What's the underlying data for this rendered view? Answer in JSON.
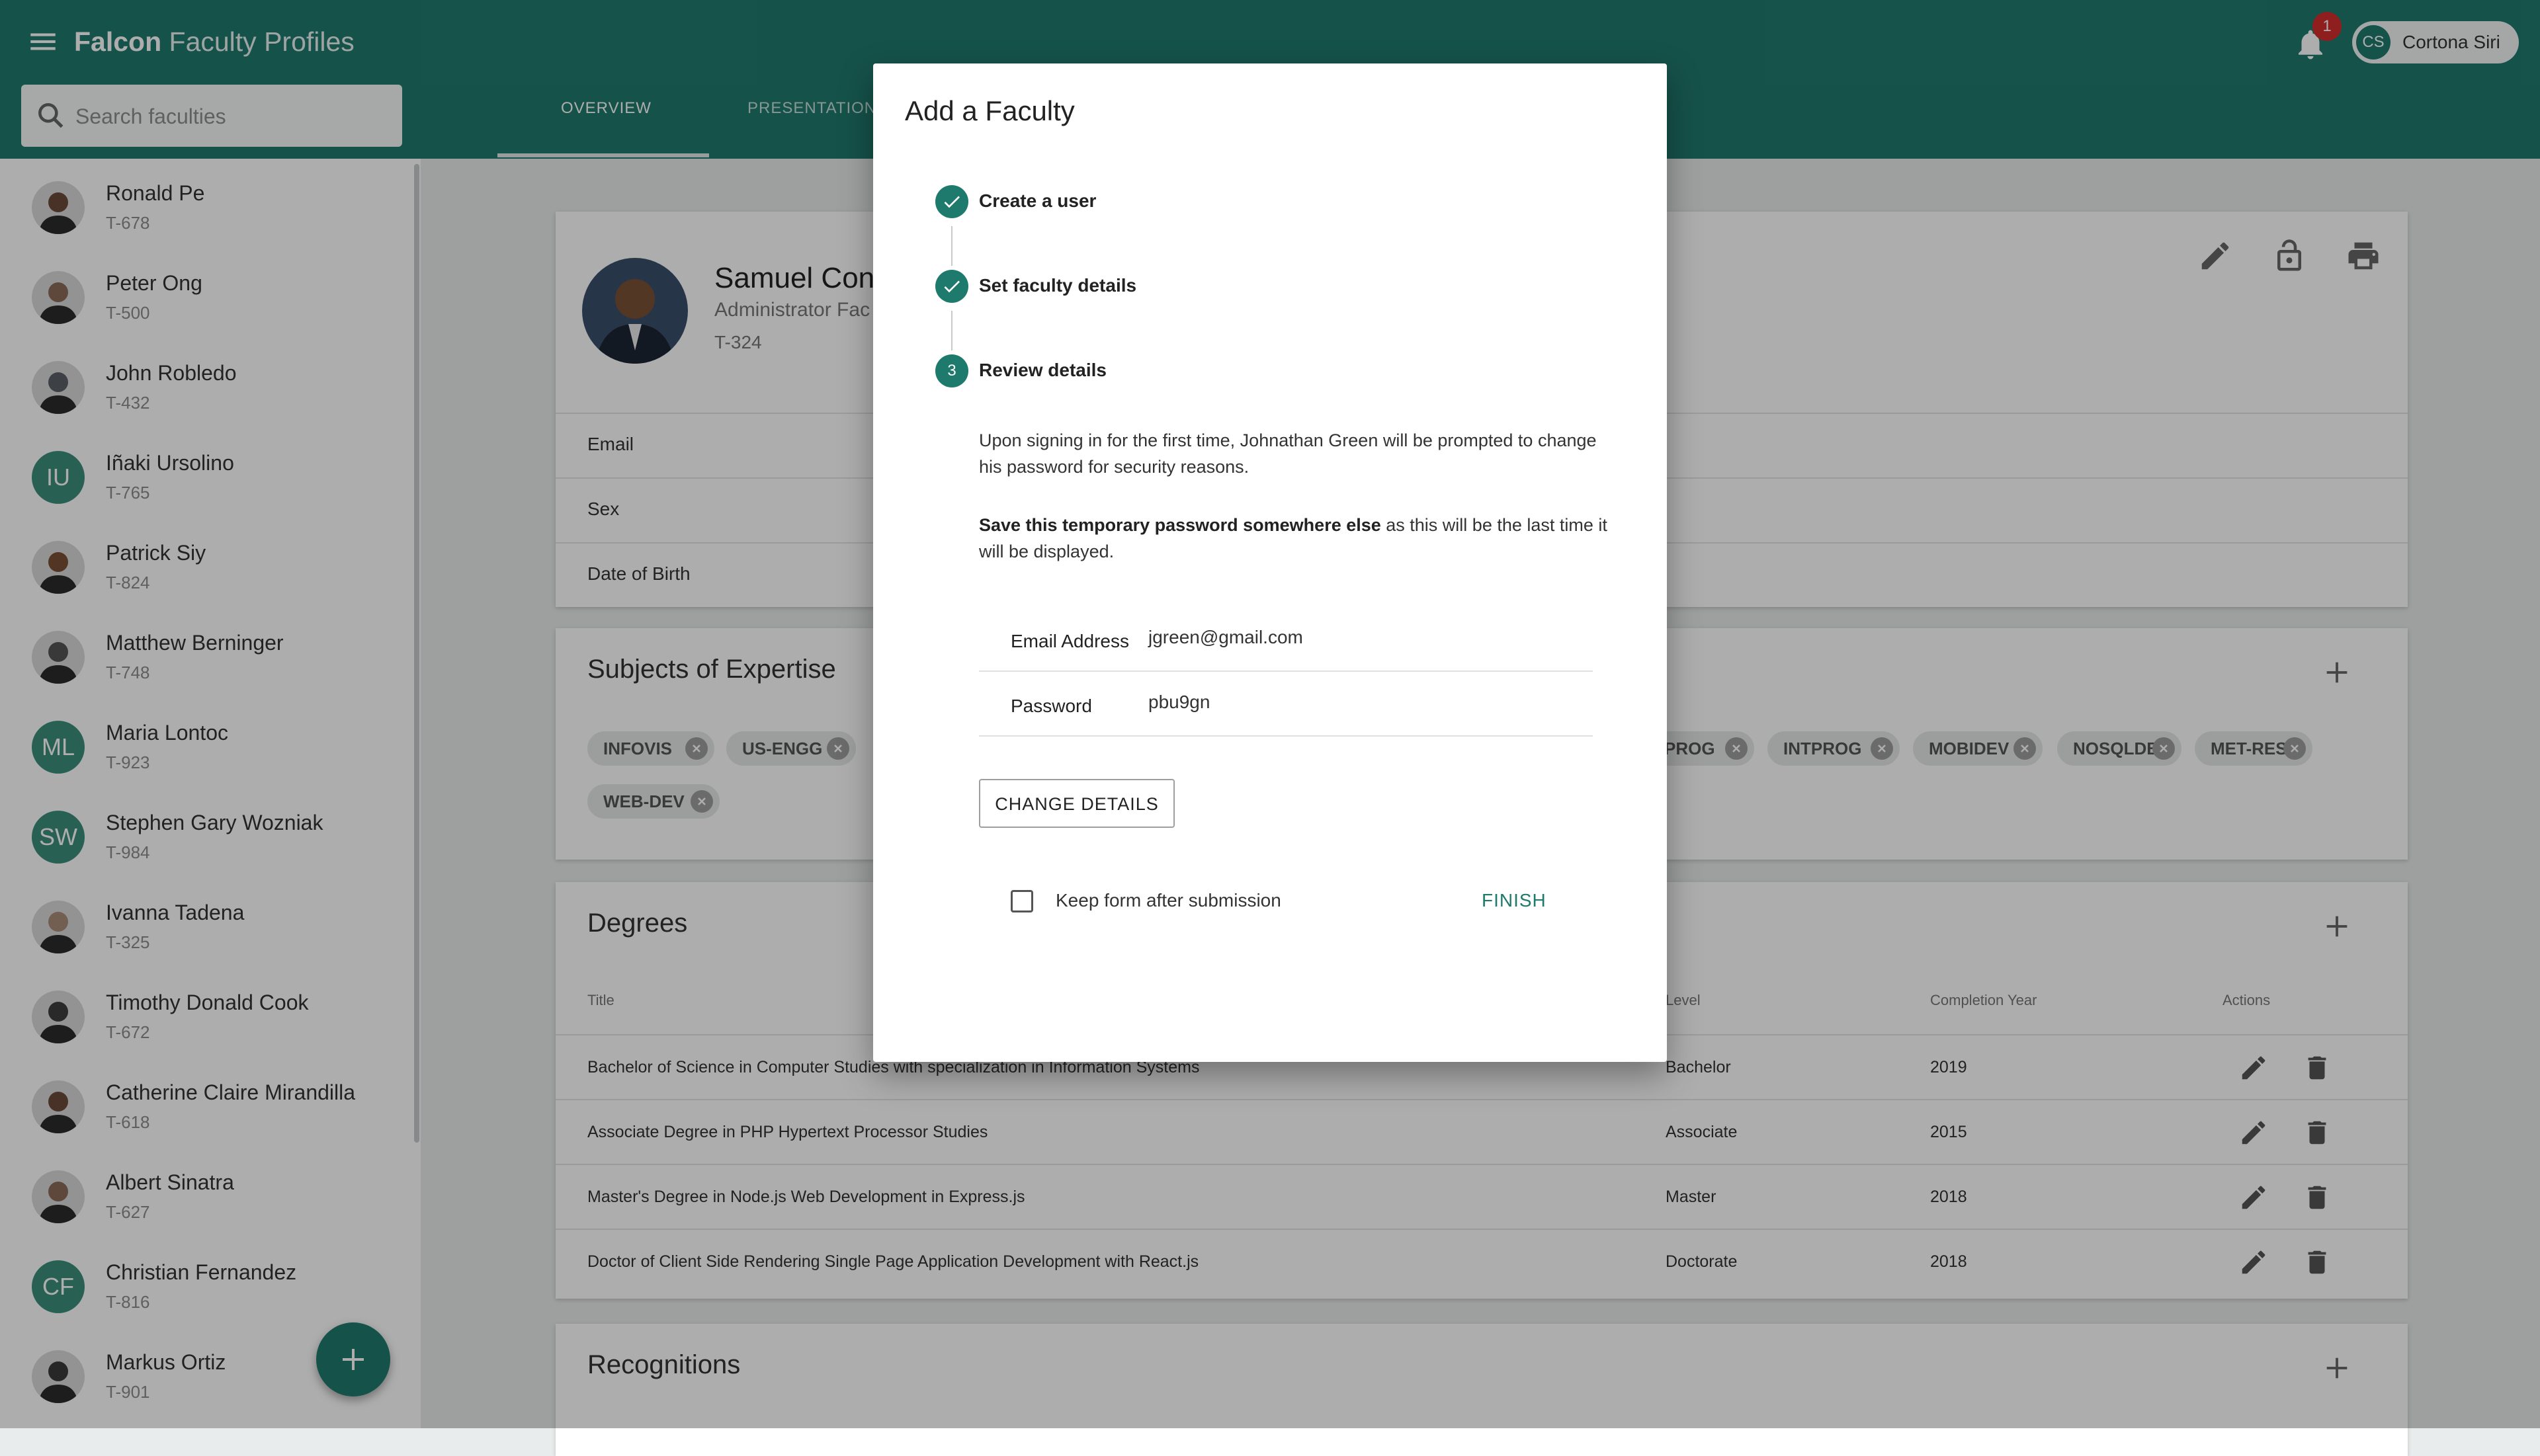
{
  "app": {
    "title_bold": "Falcon",
    "title_rest": " Faculty Profiles",
    "search_placeholder": "Search faculties",
    "tabs": [
      "OVERVIEW",
      "PRESENTATION"
    ],
    "notification_count": "1",
    "user": {
      "initials": "CS",
      "name": "Cortona Siri"
    }
  },
  "sidebar": {
    "faculties": [
      {
        "name": "Ronald Pe",
        "id": "T-678",
        "avatar": "photo"
      },
      {
        "name": "Peter Ong",
        "id": "T-500",
        "avatar": "photo"
      },
      {
        "name": "John Robledo",
        "id": "T-432",
        "avatar": "photo"
      },
      {
        "name": "Iñaki Ursolino",
        "id": "T-765",
        "avatar": "IU"
      },
      {
        "name": "Patrick Siy",
        "id": "T-824",
        "avatar": "photo"
      },
      {
        "name": "Matthew Berninger",
        "id": "T-748",
        "avatar": "photo"
      },
      {
        "name": "Maria Lontoc",
        "id": "T-923",
        "avatar": "ML"
      },
      {
        "name": "Stephen Gary Wozniak",
        "id": "T-984",
        "avatar": "SW"
      },
      {
        "name": "Ivanna Tadena",
        "id": "T-325",
        "avatar": "photo"
      },
      {
        "name": "Timothy Donald Cook",
        "id": "T-672",
        "avatar": "photo"
      },
      {
        "name": "Catherine Claire Mirandilla",
        "id": "T-618",
        "avatar": "photo"
      },
      {
        "name": "Albert Sinatra",
        "id": "T-627",
        "avatar": "photo"
      },
      {
        "name": "Christian Fernandez",
        "id": "T-816",
        "avatar": "CF"
      },
      {
        "name": "Markus Ortiz",
        "id": "T-901",
        "avatar": "photo"
      }
    ]
  },
  "profile": {
    "name": "Samuel Cona",
    "role": "Administrator Fac",
    "id": "T-324",
    "fields": [
      "Email",
      "Sex",
      "Date of Birth"
    ]
  },
  "subjects": {
    "title": "Subjects of Expertise",
    "chips_left": [
      "INFOVIS",
      "US-ENGG"
    ],
    "chips_right": [
      "PROG",
      "INTPROG",
      "MOBIDEV",
      "NOSQLDB",
      "MET-RES"
    ],
    "chips_row2": [
      "WEB-DEV"
    ]
  },
  "degrees": {
    "title": "Degrees",
    "headers": {
      "title": "Title",
      "level": "Level",
      "year": "Completion Year",
      "actions": "Actions"
    },
    "rows": [
      {
        "title": "Bachelor of Science in Computer Studies with specialization in Information Systems",
        "level": "Bachelor",
        "year": "2019"
      },
      {
        "title": "Associate Degree in PHP Hypertext Processor Studies",
        "level": "Associate",
        "year": "2015"
      },
      {
        "title": "Master's Degree in Node.js Web Development in Express.js",
        "level": "Master",
        "year": "2018"
      },
      {
        "title": "Doctor of Client Side Rendering Single Page Application Development with React.js",
        "level": "Doctorate",
        "year": "2018"
      }
    ]
  },
  "recognitions": {
    "title": "Recognitions"
  },
  "dialog": {
    "title": "Add a Faculty",
    "steps": [
      {
        "label": "Create a user",
        "state": "done"
      },
      {
        "label": "Set faculty details",
        "state": "done"
      },
      {
        "label": "Review details",
        "state": "active",
        "number": "3"
      }
    ],
    "paragraph1": "Upon signing in for the first time, Johnathan Green will be prompted to change his password for security reasons.",
    "paragraph2_bold": "Save this temporary password somewhere else",
    "paragraph2_rest": " as this will be the last time it will be displayed.",
    "credentials": [
      {
        "label": "Email Address",
        "value": "jgreen@gmail.com"
      },
      {
        "label": "Password",
        "value": "pbu9gn"
      }
    ],
    "change_button": "CHANGE DETAILS",
    "keep_form_label": "Keep form after submission",
    "finish_button": "FINISH"
  },
  "colors": {
    "primary": "#1f7a6e",
    "badge": "#d32f2f",
    "initials_avatar": "#3c8f7c"
  }
}
